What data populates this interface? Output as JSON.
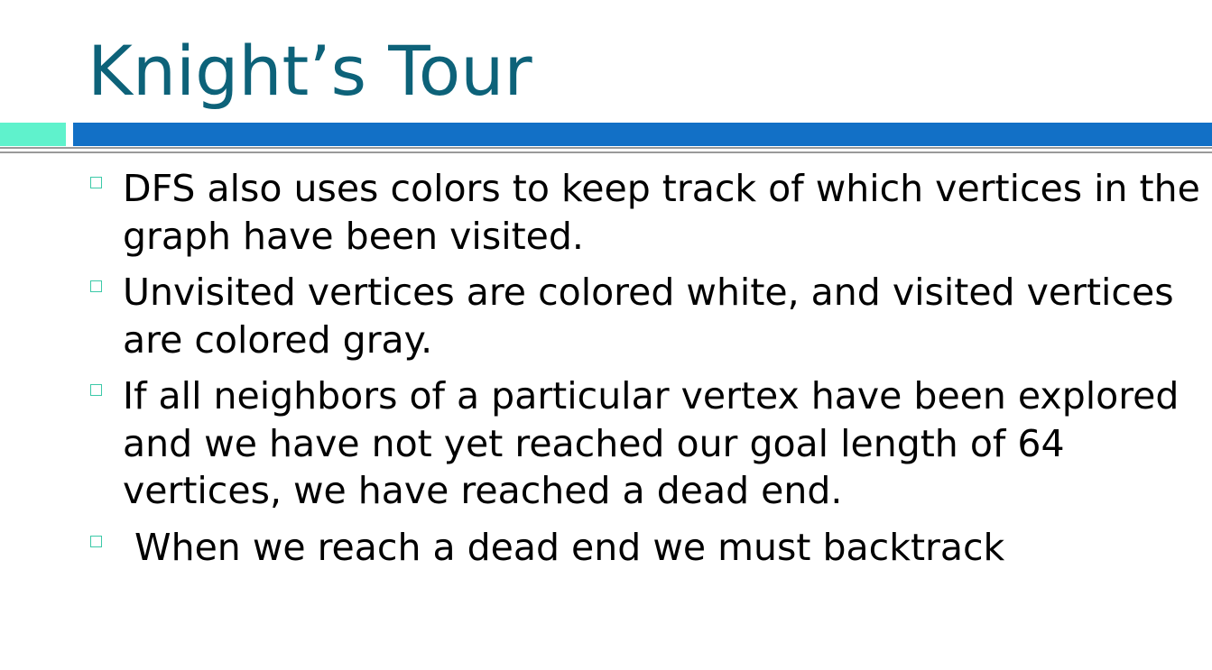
{
  "slide": {
    "title": "Knight’s Tour",
    "bullets": [
      {
        "text": "DFS also uses colors to keep track of which vertices in the graph have been visited."
      },
      {
        "text": "Unvisited vertices are colored white, and visited vertices are colored gray."
      },
      {
        "text": "If all neighbors of a particular vertex have been explored and we have not yet reached our goal length of 64 vertices, we have reached a dead end."
      },
      {
        "text": " When we reach a dead end we must backtrack"
      }
    ]
  },
  "colors": {
    "title": "#0d6279",
    "accent_left": "#5ff2cc",
    "accent_main": "#1270c6",
    "rule": "#9a9a9a",
    "bullet_marker": "#3cc9a8"
  }
}
